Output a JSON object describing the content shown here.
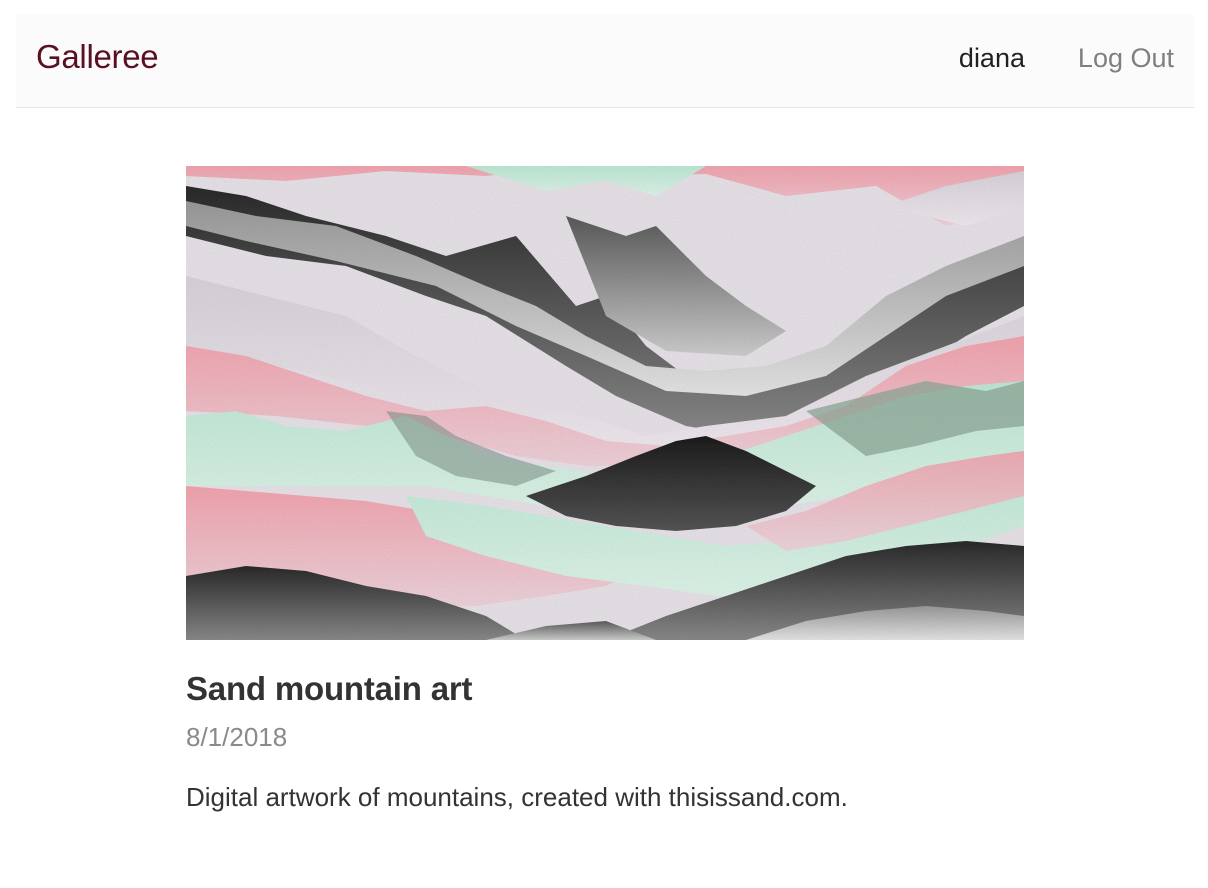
{
  "navbar": {
    "brand": "Galleree",
    "username": "diana",
    "logout_label": "Log Out"
  },
  "post": {
    "image_alt": "Sand mountain art",
    "title": "Sand mountain art",
    "date": "8/1/2018",
    "description": "Digital artwork of mountains, created with thisissand.com."
  },
  "colors": {
    "brand": "#5a1020",
    "text": "#333333",
    "muted": "#8a8a8a",
    "navbar_bg": "#fbfbfb",
    "art_pink": "#f2a9b3",
    "art_mint": "#c8ecdc",
    "art_lavender": "#e3dbe4",
    "art_dark": "#2c2c2c"
  }
}
